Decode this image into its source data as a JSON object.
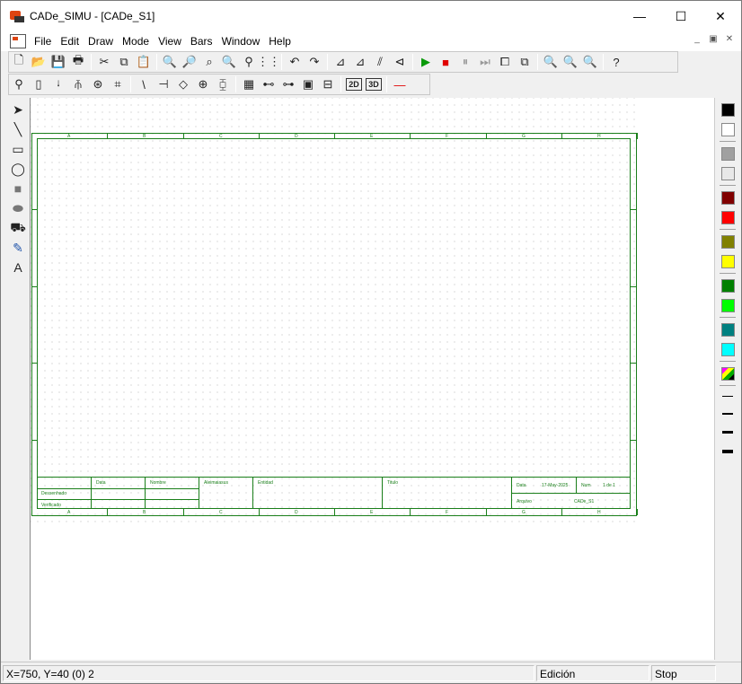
{
  "window": {
    "title": "CADe_SIMU - [CADe_S1]",
    "minimize": "—",
    "maximize": "☐",
    "close": "✕"
  },
  "menu": {
    "items": [
      "File",
      "Edit",
      "Draw",
      "Mode",
      "View",
      "Bars",
      "Window",
      "Help"
    ]
  },
  "mdi": {
    "minimize": "_",
    "restore": "▣",
    "close": "✕"
  },
  "toolbar_main": [
    {
      "name": "new-icon",
      "glyph": "🗋"
    },
    {
      "name": "open-icon",
      "glyph": "📂"
    },
    {
      "name": "save-icon",
      "glyph": "💾"
    },
    {
      "name": "print-icon",
      "glyph": "🖶"
    },
    {
      "sep": true
    },
    {
      "name": "cut-icon",
      "glyph": "✂"
    },
    {
      "name": "copy-icon",
      "glyph": "⧉"
    },
    {
      "name": "paste-icon",
      "glyph": "📋"
    },
    {
      "sep": true
    },
    {
      "name": "find-icon",
      "glyph": "🔍"
    },
    {
      "name": "find-next-icon",
      "glyph": "🔎"
    },
    {
      "name": "zoom-area-icon",
      "glyph": "⌕"
    },
    {
      "name": "zoom-sel-icon",
      "glyph": "🔍"
    },
    {
      "name": "zoom-pan-icon",
      "glyph": "⚲"
    },
    {
      "name": "grid-icon",
      "glyph": "⋮⋮"
    },
    {
      "sep": true
    },
    {
      "name": "undo-icon",
      "glyph": "↶"
    },
    {
      "name": "redo-icon",
      "glyph": "↷"
    },
    {
      "sep": true
    },
    {
      "name": "align-left-icon",
      "glyph": "⊿"
    },
    {
      "name": "align-right-icon",
      "glyph": "⊿"
    },
    {
      "name": "mirror-icon",
      "glyph": "⫽"
    },
    {
      "name": "rotate-icon",
      "glyph": "⊲"
    },
    {
      "sep": true
    },
    {
      "name": "play-icon",
      "glyph": "▶",
      "color": "#0a9a0a"
    },
    {
      "name": "stop-icon",
      "glyph": "■",
      "color": "#e00000"
    },
    {
      "name": "pause-icon",
      "glyph": "⏸",
      "color": "#999"
    },
    {
      "name": "step-icon",
      "glyph": "⏭",
      "color": "#999"
    },
    {
      "name": "window-icon",
      "glyph": "⧠"
    },
    {
      "name": "windows-icon",
      "glyph": "⧉"
    },
    {
      "sep": true
    },
    {
      "name": "zoom-in-icon",
      "glyph": "🔍"
    },
    {
      "name": "zoom-out-icon",
      "glyph": "🔍"
    },
    {
      "name": "zoom-fit-icon",
      "glyph": "🔍"
    },
    {
      "sep": true
    },
    {
      "name": "help-icon",
      "glyph": "?"
    }
  ],
  "toolbar_components": [
    {
      "name": "supply-icon",
      "glyph": "⚲"
    },
    {
      "name": "fuse-icon",
      "glyph": "▯"
    },
    {
      "name": "switch-icon",
      "glyph": "ᛍ"
    },
    {
      "name": "multi-switch-icon",
      "glyph": "⫚"
    },
    {
      "name": "motor-icon",
      "glyph": "⊛"
    },
    {
      "name": "contactor-icon",
      "glyph": "⌗"
    },
    {
      "sep": true
    },
    {
      "name": "contact-icon",
      "glyph": "\\"
    },
    {
      "name": "pushbutton-icon",
      "glyph": "⊣"
    },
    {
      "name": "sensor-icon",
      "glyph": "◇"
    },
    {
      "name": "coil-icon",
      "glyph": "⊕"
    },
    {
      "name": "relay-icon",
      "glyph": "⧮"
    },
    {
      "sep": true
    },
    {
      "name": "plc-icon",
      "glyph": "▦"
    },
    {
      "name": "valve-icon",
      "glyph": "⊷"
    },
    {
      "name": "cylinder-icon",
      "glyph": "⊶"
    },
    {
      "name": "io-icon",
      "glyph": "▣"
    },
    {
      "name": "terminal-icon",
      "glyph": "⊟"
    },
    {
      "sep": true
    },
    {
      "name": "2d-icon",
      "glyph": "2D"
    },
    {
      "name": "3d-icon",
      "glyph": "3D"
    },
    {
      "sep": true
    },
    {
      "name": "wire-icon",
      "glyph": "—",
      "color": "#e00000"
    }
  ],
  "tools_left": [
    {
      "name": "pointer-icon",
      "glyph": "➤"
    },
    {
      "name": "line-icon",
      "glyph": "╲"
    },
    {
      "name": "rect-icon",
      "glyph": "▭"
    },
    {
      "name": "ellipse-icon",
      "glyph": "◯"
    },
    {
      "name": "filled-rect-icon",
      "glyph": "■",
      "color": "#777"
    },
    {
      "name": "filled-ellipse-icon",
      "glyph": "⬬",
      "color": "#777"
    },
    {
      "name": "fill-icon",
      "glyph": "⛟"
    },
    {
      "name": "picker-icon",
      "glyph": "✎",
      "color": "#2255aa"
    },
    {
      "name": "text-icon",
      "glyph": "A"
    }
  ],
  "palette": [
    "#000000",
    "#ffffff",
    "#a0a0a0",
    "#e8e8e8",
    "#800000",
    "#ff0000",
    "#808000",
    "#ffff00",
    "#008000",
    "#00ff00",
    "#008080",
    "#00ffff"
  ],
  "title_block": {
    "col_headers": [
      "Data",
      "Nombre",
      "Aleimaiasus",
      "Entidad",
      "Titulo"
    ],
    "rows": [
      "Dessenhado",
      "Verificado"
    ],
    "date_label": "Data",
    "date_value": "17-May-2025",
    "num_label": "Num",
    "num_value": "1 de 1",
    "file_label": "Arquivo",
    "file_value": "CADe_S1"
  },
  "border_letters": [
    "A",
    "B",
    "C",
    "D",
    "E",
    "F",
    "G",
    "H"
  ],
  "status": {
    "coords": "X=750, Y=40 (0) 2",
    "mode": "Edición",
    "run": "Stop"
  }
}
